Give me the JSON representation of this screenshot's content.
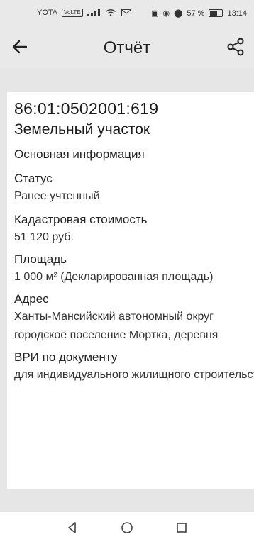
{
  "status_bar": {
    "carrier": "YOTA",
    "net_tag": "VoLTE",
    "battery": "57 %",
    "time": "13:14"
  },
  "header": {
    "title": "Отчёт"
  },
  "report": {
    "cadastral_number": "86:01:0502001:619",
    "object_type": "Земельный участок",
    "section_title": "Основная информация",
    "status_label": "Статус",
    "status_value": "Ранее учтенный",
    "cost_label": "Кадастровая стоимость",
    "cost_value": "51 120 руб.",
    "area_label": "Площадь",
    "area_value": "1 000 м² (Декларированная площадь)",
    "address_label": "Адрес",
    "address_line1": "Ханты-Мансийский автономный округ",
    "address_line2": "городское  поселение Мортка, деревня",
    "vri_label": "ВРИ по документу",
    "vri_value": "для индивидуального жилищного строительства"
  },
  "icons": {
    "back": "arrow-left-icon",
    "share": "share-icon",
    "nav_back": "triangle-back-icon",
    "nav_home": "circle-home-icon",
    "nav_recent": "square-recent-icon"
  }
}
